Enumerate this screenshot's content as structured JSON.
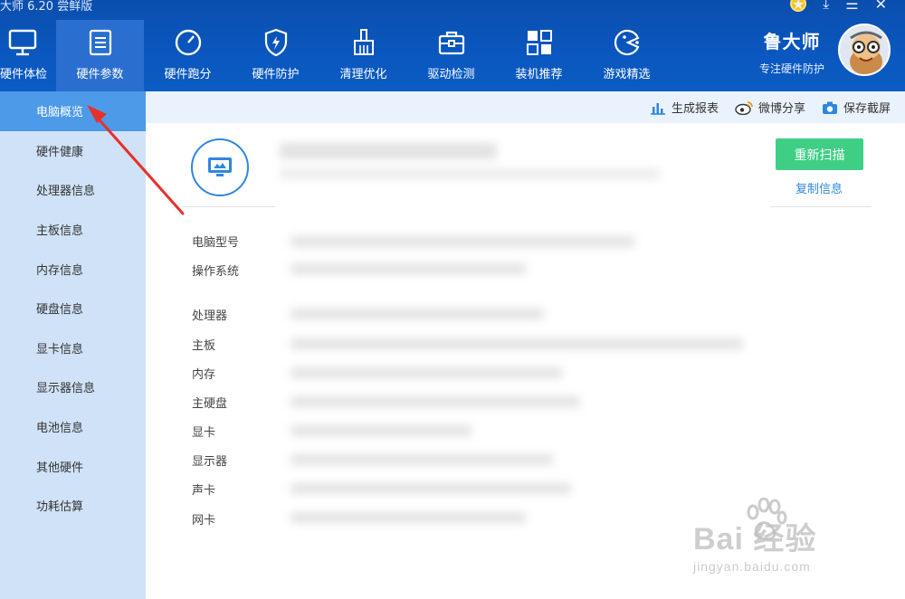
{
  "window": {
    "title": "大师 6.20 尝鲜版",
    "controls": [
      "★",
      "⤓",
      "☰",
      "✕"
    ]
  },
  "nav": {
    "items": [
      {
        "label": "硬件体检",
        "icon": "monitor-icon"
      },
      {
        "label": "硬件参数",
        "icon": "list-icon"
      },
      {
        "label": "硬件跑分",
        "icon": "speedometer-icon"
      },
      {
        "label": "硬件防护",
        "icon": "shield-icon"
      },
      {
        "label": "清理优化",
        "icon": "broom-icon"
      },
      {
        "label": "驱动检测",
        "icon": "toolbox-icon"
      },
      {
        "label": "装机推荐",
        "icon": "grid-icon"
      },
      {
        "label": "游戏精选",
        "icon": "gamepad-icon"
      }
    ],
    "active_index": 1
  },
  "brand": {
    "name": "鲁大师",
    "slogan": "专注硬件防护"
  },
  "sidebar": {
    "items": [
      {
        "label": "电脑概览"
      },
      {
        "label": "硬件健康"
      },
      {
        "label": "处理器信息"
      },
      {
        "label": "主板信息"
      },
      {
        "label": "内存信息"
      },
      {
        "label": "硬盘信息"
      },
      {
        "label": "显卡信息"
      },
      {
        "label": "显示器信息"
      },
      {
        "label": "电池信息"
      },
      {
        "label": "其他硬件"
      },
      {
        "label": "功耗估算"
      }
    ],
    "active_index": 0
  },
  "toolbar": {
    "report_label": "生成报表",
    "share_label": "微博分享",
    "screenshot_label": "保存截屏"
  },
  "overview": {
    "rescan_label": "重新扫描",
    "copy_label": "复制信息",
    "labels": [
      "电脑型号",
      "操作系统",
      "处理器",
      "主板",
      "内存",
      "主硬盘",
      "显卡",
      "显示器",
      "声卡",
      "网卡"
    ]
  },
  "watermark": {
    "main": "Bai 经验",
    "sub": "jingyan.baidu.com"
  },
  "colors": {
    "header_bg": "#0b54b8",
    "sidebar_bg": "#cfe2f7",
    "sidebar_active": "#4d9ae8",
    "accent_green": "#3fcf84",
    "link_blue": "#2f86e0",
    "annotation_red": "#e8302a"
  }
}
